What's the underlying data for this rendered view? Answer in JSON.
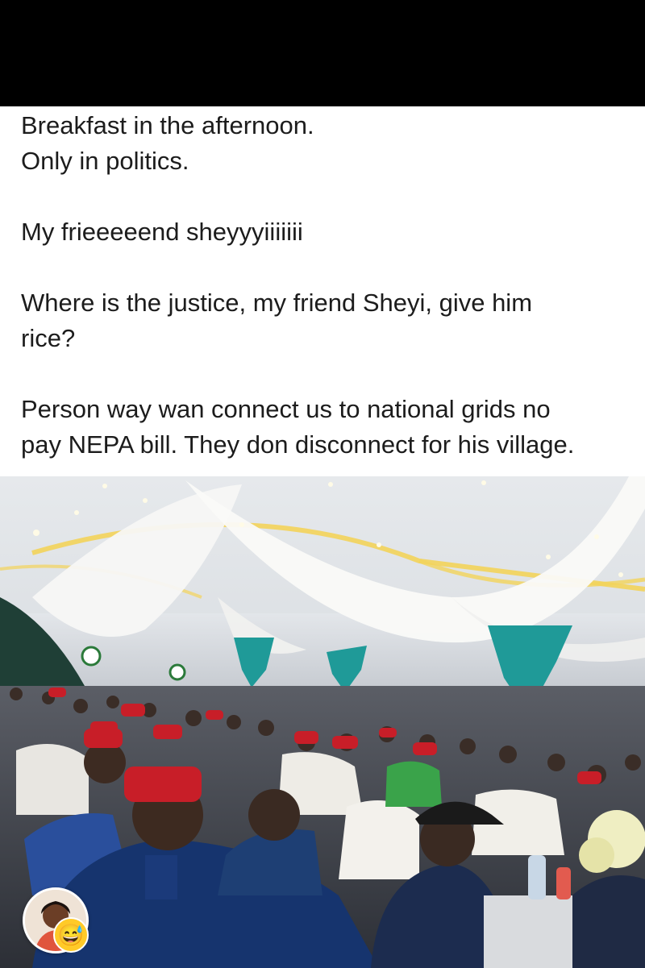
{
  "post": {
    "lines": [
      "Breakfast in the afternoon.",
      "Only in politics.",
      "My frieeeeend sheyyyiiiiiii",
      "Where is the justice, my friend Sheyi, give him",
      "rice?",
      "Person way wan connect us to national grids no",
      "pay NEPA bill. They don disconnect for his village."
    ]
  },
  "photo": {
    "description_icon": "event-hall-photo",
    "colors": {
      "ceiling": "#e9ecef",
      "drape": "#f7f7f5",
      "teal_curtain": "#1f9a98",
      "red_cap": "#c81e28",
      "blue_attire": "#2a4f9c",
      "ceiling_light": "#f3d35a"
    }
  },
  "reactions": {
    "avatar_icon": "user-avatar-icon",
    "emoji_icon": "grinning-sweat-emoji-icon",
    "emoji": "😅"
  }
}
